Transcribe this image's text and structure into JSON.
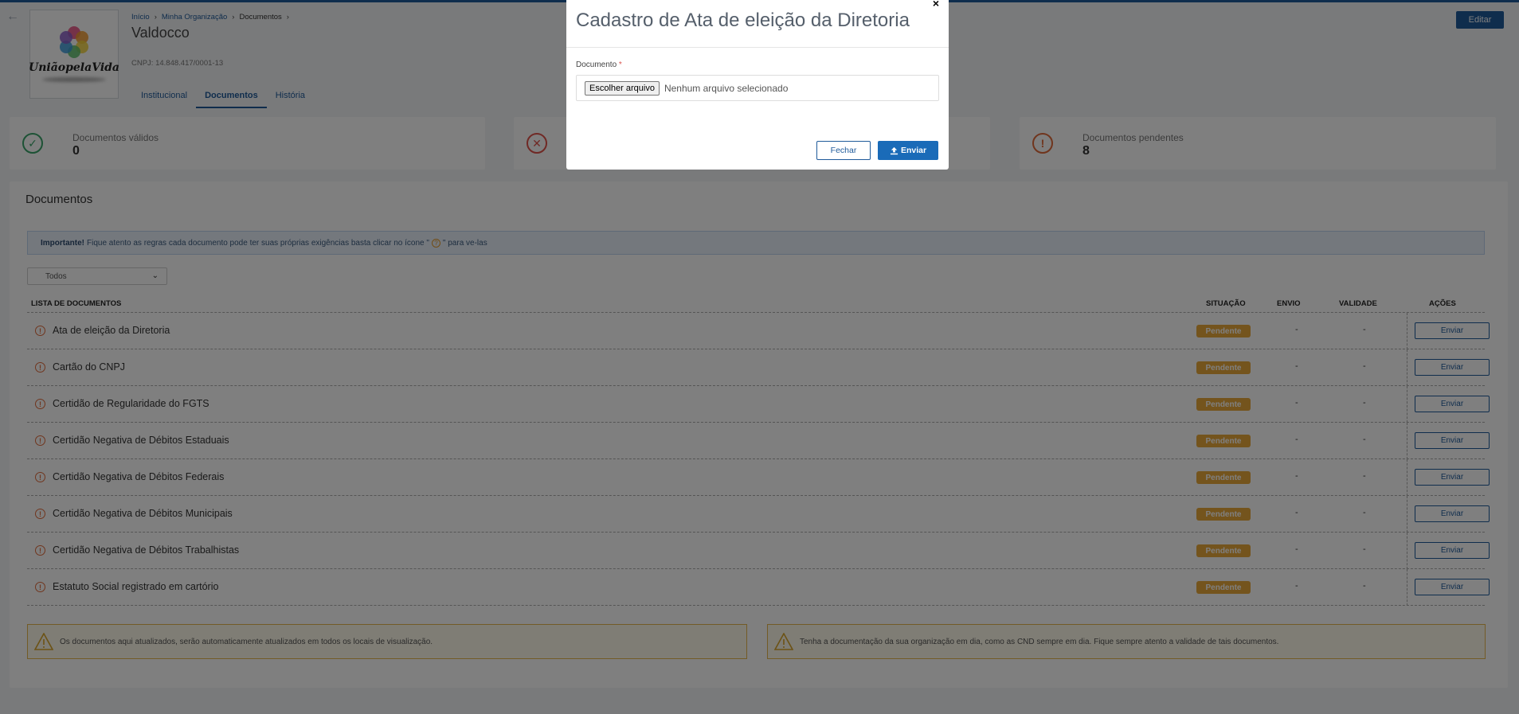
{
  "header": {
    "breadcrumb": [
      "Início",
      "Minha Organização",
      "Documentos"
    ],
    "org_name": "Valdocco",
    "cnpj": "CNPJ: 14.848.417/0001-13",
    "edit_label": "Editar",
    "logo_text": "UniãopelaVida"
  },
  "tabs": [
    {
      "label": "Institucional",
      "active": false
    },
    {
      "label": "Documentos",
      "active": true
    },
    {
      "label": "História",
      "active": false
    }
  ],
  "stats": [
    {
      "label": "Documentos válidos",
      "value": "0",
      "icon": "check-circle-icon",
      "color": "#3aa56b"
    },
    {
      "label": "",
      "value": "",
      "icon": "x-circle-icon",
      "color": "#e0524a"
    },
    {
      "label": "Documentos pendentes",
      "value": "8",
      "icon": "exclamation-circle-icon",
      "color": "#e06a3a"
    }
  ],
  "panel": {
    "title": "Documentos",
    "info_bold": "Importante!",
    "info_text_a": "Fique atento as regras cada documento pode ter suas próprias exigências basta clicar no ícone \"",
    "info_text_b": "\" para ve-las",
    "filter_value": "Todos",
    "columns": {
      "name": "LISTA DE DOCUMENTOS",
      "status": "SITUAÇÃO",
      "sent": "ENVIO",
      "validity": "VALIDADE",
      "actions": "AÇÕES"
    },
    "rows": [
      {
        "name": "Ata de eleição da Diretoria",
        "status": "Pendente",
        "sent": "-",
        "validity": "-",
        "action": "Enviar"
      },
      {
        "name": "Cartão do CNPJ",
        "status": "Pendente",
        "sent": "-",
        "validity": "-",
        "action": "Enviar"
      },
      {
        "name": "Certidão de Regularidade do FGTS",
        "status": "Pendente",
        "sent": "-",
        "validity": "-",
        "action": "Enviar"
      },
      {
        "name": "Certidão Negativa de Débitos Estaduais",
        "status": "Pendente",
        "sent": "-",
        "validity": "-",
        "action": "Enviar"
      },
      {
        "name": "Certidão Negativa de Débitos Federais",
        "status": "Pendente",
        "sent": "-",
        "validity": "-",
        "action": "Enviar"
      },
      {
        "name": "Certidão Negativa de Débitos Municipais",
        "status": "Pendente",
        "sent": "-",
        "validity": "-",
        "action": "Enviar"
      },
      {
        "name": "Certidão Negativa de Débitos Trabalhistas",
        "status": "Pendente",
        "sent": "-",
        "validity": "-",
        "action": "Enviar"
      },
      {
        "name": "Estatuto Social registrado em cartório",
        "status": "Pendente",
        "sent": "-",
        "validity": "-",
        "action": "Enviar"
      }
    ],
    "warnings": [
      "Os documentos aqui atualizados, serão automaticamente atualizados em todos os locais de visualização.",
      "Tenha a documentação da sua organização em dia, como as CND sempre em dia. Fique sempre atento a validade de tais documentos."
    ]
  },
  "modal": {
    "title": "Cadastro de Ata de eleição da Diretoria",
    "field_label": "Documento",
    "required_mark": "*",
    "file_button": "Escolher arquivo",
    "file_status": "Nenhum arquivo selecionado",
    "close_label": "Fechar",
    "send_label": "Enviar",
    "close_icon": "×"
  },
  "colors": {
    "primary": "#1f5a9a",
    "pending": "#e9a93a",
    "warning_border": "#e6b74d"
  }
}
